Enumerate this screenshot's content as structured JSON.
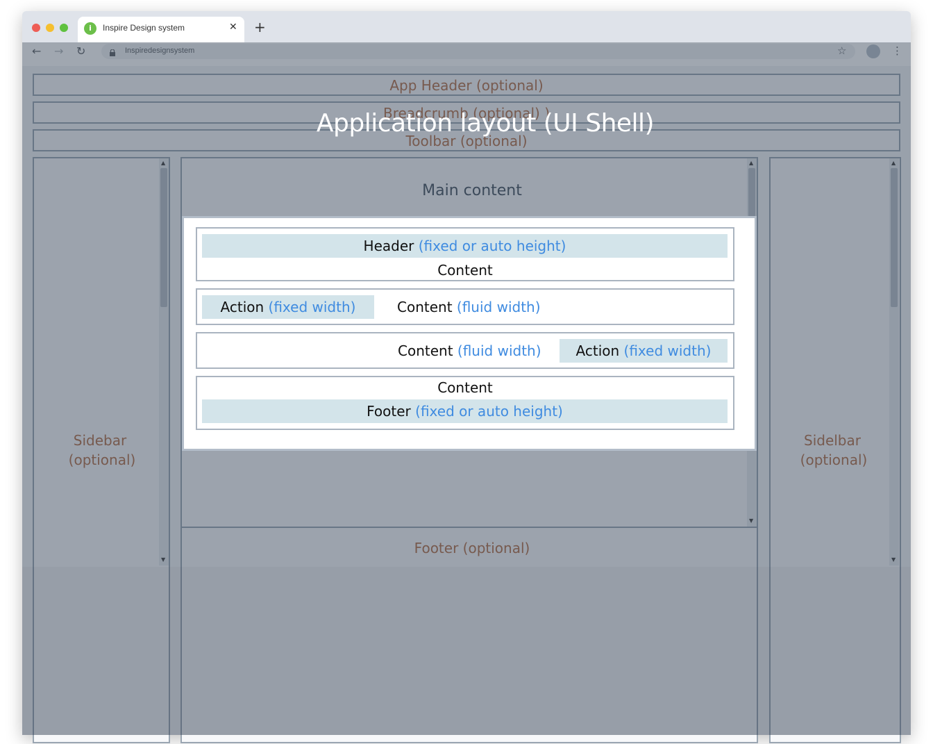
{
  "browser": {
    "tab_title": "Inspire Design system",
    "tab_logo_letter": "i",
    "url": "Inspiredesignsystem",
    "icons": [
      "back-arrow-icon",
      "forward-arrow-icon",
      "reload-icon",
      "lock-icon",
      "star-icon",
      "profile-icon",
      "more-menu-icon",
      "close-icon",
      "plus-icon"
    ],
    "traffic_light_colors": [
      "#ee5d55",
      "#f5bf2f",
      "#5fc13f"
    ]
  },
  "page_title": "Application layout (UI Shell)",
  "regions": {
    "app_header": "App Header (optional)",
    "breadcrumb": "Breadcrumb (optional) )",
    "toolbar": "Toolbar (optional)",
    "left_sidebar": [
      "Sidebar",
      "(optional)"
    ],
    "right_sidebar": [
      "Sidelbar",
      "(optional)"
    ],
    "main_content": "Main content",
    "footer": "Footer (optional)"
  },
  "patterns": {
    "header_content": {
      "header": "Header",
      "header_hint": "(fixed or auto height)",
      "content": "Content"
    },
    "action_left": {
      "action": "Action",
      "action_hint": "(fixed width)",
      "content": "Content",
      "content_hint": "(fluid width)"
    },
    "action_right": {
      "content": "Content",
      "content_hint": "(fluid width)",
      "action": "Action",
      "action_hint": "(fixed width)"
    },
    "content_footer": {
      "content": "Content",
      "footer": "Footer",
      "footer_hint": "(fixed or auto height)"
    }
  },
  "colors": {
    "region_label": "#b5734e",
    "hint_text": "#3f8be0",
    "shaded_cell": "#d3e4ea"
  }
}
